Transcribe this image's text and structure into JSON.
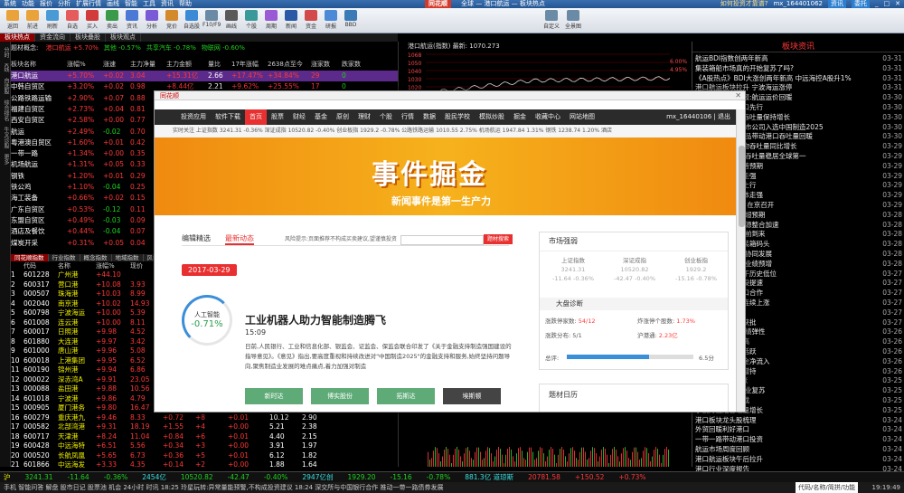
{
  "titlebar": {
    "menus": [
      "系统",
      "功能",
      "报价",
      "分析",
      "扩展行情",
      "画线",
      "智能",
      "工具",
      "资讯",
      "帮助"
    ],
    "brand": "同花顺",
    "window_title": "全球 — 港口航运 — 板块热点",
    "question": "如何投资才靠谱?",
    "user": "mx_164401062",
    "right_btns": [
      "资讯",
      "委托"
    ]
  },
  "toolbar": {
    "labels": [
      "返回",
      "前进",
      "刷新",
      "自选",
      "买入",
      "卖出",
      "资讯",
      "分析",
      "竞价",
      "自选股",
      "F10/F9",
      "画线",
      "个股",
      "周期",
      "新闻",
      "资金",
      "研报",
      "BBD"
    ],
    "right_labels": [
      "自定义",
      "全景图"
    ]
  },
  "tabs": [
    "板块热点",
    "资金流向",
    "板块叠股",
    "板块观点"
  ],
  "left_side": [
    "分时",
    "K线",
    "自选股",
    "综合排名",
    "牛叉诊股",
    "更多"
  ],
  "info_line": {
    "label": "题材概念:",
    "items": [
      {
        "t": "港口航运 +5.70%",
        "c": "up"
      },
      {
        "t": "其他 -0.57%",
        "c": "dn"
      },
      {
        "t": "共享汽车 -0.78%",
        "c": "dn"
      },
      {
        "t": "物联网 -0.60%",
        "c": "dn"
      }
    ]
  },
  "table_headers": [
    "板块名称",
    "涨幅%",
    "涨速",
    "主力净量",
    "主力金额",
    "量比",
    "17年涨幅",
    "2638点至今",
    "涨家数",
    "跌家数"
  ],
  "sectors": [
    {
      "n": "港口航运",
      "z": "+5.70%",
      "s": "+0.02",
      "a": "3.04",
      "b": "+15.31亿",
      "c": "2.66",
      "d": "+17.47%",
      "e": "+34.84%",
      "f": "29",
      "g": "0",
      "sel": true
    },
    {
      "n": "中韩自贸区",
      "z": "+3.20%",
      "s": "+0.02",
      "a": "0.98",
      "b": "+8.44亿",
      "c": "2.21",
      "d": "+9.62%",
      "e": "+25.55%",
      "f": "17",
      "g": "0"
    },
    {
      "n": "公路铁路运输",
      "z": "+2.90%",
      "s": "+0.07",
      "a": "0.88",
      "b": "+4.82亿",
      "c": "2.63",
      "d": "+12.06%",
      "e": "+35.33%",
      "f": "18",
      "g": "4"
    },
    {
      "n": "福建自贸区",
      "z": "+2.73%",
      "s": "+0.04",
      "a": "0.81",
      "b": "+3.55亿",
      "c": "2.01",
      "d": "+7.04%",
      "e": "+21.83%",
      "f": "15",
      "g": "2"
    },
    {
      "n": "西安自贸区",
      "z": "+2.58%",
      "s": "+0.00",
      "a": "0.77",
      "b": "+2.41亿",
      "c": "1.92",
      "d": "+6.33%",
      "e": "+19.70%",
      "f": "12",
      "g": "3"
    },
    {
      "n": "航运",
      "z": "+2.49%",
      "s": "-0.02",
      "a": "0.70",
      "b": "+2.20亿",
      "c": "1.88",
      "d": "+5.90%",
      "e": "+28.12%",
      "f": "11",
      "g": "1"
    },
    {
      "n": "粤港澳自贸区",
      "z": "+1.60%",
      "s": "+0.01",
      "a": "0.42",
      "b": "+1.87亿",
      "c": "1.55",
      "d": "+4.22%",
      "e": "+17.44%",
      "f": "14",
      "g": "5"
    },
    {
      "n": "一带一路",
      "z": "+1.34%",
      "s": "+0.00",
      "a": "0.35",
      "b": "+1.51亿",
      "c": "1.47",
      "d": "+3.98%",
      "e": "+22.06%",
      "f": "60",
      "g": "21"
    },
    {
      "n": "机场航运",
      "z": "+1.31%",
      "s": "+0.05",
      "a": "0.33",
      "b": "+1.12亿",
      "c": "1.40",
      "d": "+3.55%",
      "e": "+15.20%",
      "f": "9",
      "g": "2"
    },
    {
      "n": "钢铁",
      "z": "+1.20%",
      "s": "+0.01",
      "a": "0.29",
      "b": "+0.95亿",
      "c": "1.33",
      "d": "+3.10%",
      "e": "+30.51%",
      "f": "22",
      "g": "8"
    },
    {
      "n": "铁公鸡",
      "z": "+1.10%",
      "s": "-0.04",
      "a": "0.25",
      "b": "+0.80亿",
      "c": "1.28",
      "d": "+2.74%",
      "e": "+18.66%",
      "f": "30",
      "g": "10"
    },
    {
      "n": "海工装备",
      "z": "+0.66%",
      "s": "+0.02",
      "a": "0.15",
      "b": "+0.44亿",
      "c": "1.19",
      "d": "+1.90%",
      "e": "+12.38%",
      "f": "10",
      "g": "6"
    },
    {
      "n": "广东自贸区",
      "z": "+0.53%",
      "s": "-0.12",
      "a": "0.11",
      "b": "+0.31亿",
      "c": "1.14",
      "d": "+1.41%",
      "e": "+14.90%",
      "f": "13",
      "g": "8"
    },
    {
      "n": "东盟自贸区",
      "z": "+0.49%",
      "s": "-0.03",
      "a": "0.09",
      "b": "+0.22亿",
      "c": "1.10",
      "d": "+1.05%",
      "e": "+11.72%",
      "f": "8",
      "g": "5"
    },
    {
      "n": "酒店及餐饮",
      "z": "+0.44%",
      "s": "-0.04",
      "a": "0.07",
      "b": "+0.10亿",
      "c": "1.06",
      "d": "+0.98%",
      "e": "+9.85%",
      "f": "5",
      "g": "4"
    },
    {
      "n": "煤炭开采",
      "z": "+0.31%",
      "s": "+0.05",
      "a": "0.04",
      "b": "+0.06亿",
      "c": "1.02",
      "d": "+0.61%",
      "e": "+20.41%",
      "f": "16",
      "g": "12"
    }
  ],
  "low_tabs": [
    "同花顺指数",
    "行业指数",
    "概念指数",
    "地域指数",
    "风格指数"
  ],
  "stock_headers": [
    "代码",
    "名称",
    "涨幅%",
    "现价",
    "涨跌",
    "买价",
    "卖价",
    "总手",
    "现手",
    "换手%",
    "量比"
  ],
  "stocks": [
    {
      "i": "1",
      "code": "601228",
      "n": "广州港",
      "z": "+44.10",
      "p": "",
      "d": "",
      "v": "",
      "x": "",
      "t": "",
      "q": ""
    },
    {
      "i": "2",
      "code": "600317",
      "n": "营口港",
      "z": "+10.08",
      "p": "3.93",
      "d": "+0.36",
      "v": "+21",
      "x": "+0.03",
      "t": "20.51",
      "q": "4.86"
    },
    {
      "i": "3",
      "code": "000507",
      "n": "珠海港",
      "z": "+10.03",
      "p": "8.99",
      "d": "+0.82",
      "v": "+17",
      "x": "+0.01",
      "t": "18.44",
      "q": "3.91"
    },
    {
      "i": "4",
      "code": "002040",
      "n": "南京港",
      "z": "+10.02",
      "p": "14.93",
      "d": "+1.36",
      "v": "+12",
      "x": "+0.00",
      "t": "9.75",
      "q": "3.07"
    },
    {
      "i": "5",
      "code": "600798",
      "n": "宁波海运",
      "z": "+10.00",
      "p": "5.39",
      "d": "+0.49",
      "v": "+9",
      "x": "+0.00",
      "t": "7.66",
      "q": "2.95"
    },
    {
      "i": "6",
      "code": "601008",
      "n": "连云港",
      "z": "+10.00",
      "p": "8.11",
      "d": "+0.74",
      "v": "+14",
      "x": "+0.01",
      "t": "15.30",
      "q": "4.11"
    },
    {
      "i": "7",
      "code": "600017",
      "n": "日照港",
      "z": "+9.98",
      "p": "4.52",
      "d": "+0.41",
      "v": "+10",
      "x": "+0.00",
      "t": "11.92",
      "q": "3.36"
    },
    {
      "i": "8",
      "code": "601880",
      "n": "大连港",
      "z": "+9.97",
      "p": "3.42",
      "d": "+0.31",
      "v": "+8",
      "x": "+0.00",
      "t": "6.48",
      "q": "3.18"
    },
    {
      "i": "9",
      "code": "601000",
      "n": "唐山港",
      "z": "+9.96",
      "p": "5.08",
      "d": "+0.46",
      "v": "+11",
      "x": "+0.01",
      "t": "5.92",
      "q": "2.84"
    },
    {
      "i": "10",
      "code": "600018",
      "n": "上港集团",
      "z": "+9.95",
      "p": "6.52",
      "d": "+0.59",
      "v": "+13",
      "x": "+0.00",
      "t": "2.11",
      "q": "3.55"
    },
    {
      "i": "11",
      "code": "600190",
      "n": "锦州港",
      "z": "+9.94",
      "p": "6.86",
      "d": "+0.62",
      "v": "+16",
      "x": "+0.02",
      "t": "13.07",
      "q": "4.20"
    },
    {
      "i": "12",
      "code": "000022",
      "n": "深赤湾A",
      "z": "+9.91",
      "p": "23.05",
      "d": "+2.08",
      "v": "+7",
      "x": "+0.01",
      "t": "3.55",
      "q": "2.61"
    },
    {
      "i": "13",
      "code": "000088",
      "n": "盐田港",
      "z": "+9.88",
      "p": "10.56",
      "d": "+0.95",
      "v": "+9",
      "x": "+0.00",
      "t": "4.88",
      "q": "2.77"
    },
    {
      "i": "14",
      "code": "601018",
      "n": "宁波港",
      "z": "+9.86",
      "p": "4.79",
      "d": "+0.43",
      "v": "+6",
      "x": "+0.00",
      "t": "1.94",
      "q": "3.02"
    },
    {
      "i": "15",
      "code": "000905",
      "n": "厦门港务",
      "z": "+9.80",
      "p": "16.47",
      "d": "+1.47",
      "v": "+5",
      "x": "+0.00",
      "t": "8.23",
      "q": "2.49"
    },
    {
      "i": "16",
      "code": "600279",
      "n": "重庆港九",
      "z": "+9.46",
      "p": "8.33",
      "d": "+0.72",
      "v": "+8",
      "x": "+0.01",
      "t": "10.12",
      "q": "2.90"
    },
    {
      "i": "17",
      "code": "000582",
      "n": "北部湾港",
      "z": "+9.31",
      "p": "18.19",
      "d": "+1.55",
      "v": "+4",
      "x": "+0.00",
      "t": "5.21",
      "q": "2.38"
    },
    {
      "i": "18",
      "code": "600717",
      "n": "天津港",
      "z": "+8.24",
      "p": "11.04",
      "d": "+0.84",
      "v": "+6",
      "x": "+0.01",
      "t": "4.40",
      "q": "2.15"
    },
    {
      "i": "19",
      "code": "600428",
      "n": "中远海特",
      "z": "+6.51",
      "p": "5.56",
      "d": "+0.34",
      "v": "+3",
      "x": "+0.00",
      "t": "3.91",
      "q": "1.97"
    },
    {
      "i": "20",
      "code": "000520",
      "n": "长航凤凰",
      "z": "+5.65",
      "p": "6.73",
      "d": "+0.36",
      "v": "+5",
      "x": "+0.01",
      "t": "6.12",
      "q": "1.82"
    },
    {
      "i": "21",
      "code": "601866",
      "n": "中远海发",
      "z": "+3.33",
      "p": "4.35",
      "d": "+0.14",
      "v": "+2",
      "x": "+0.00",
      "t": "1.88",
      "q": "1.64"
    }
  ],
  "chart": {
    "title": "港口航运(指数) 最新: 1070.273",
    "y_labels": [
      "1068",
      "1050",
      "1040",
      "1030",
      "1020",
      "1010",
      "1000"
    ],
    "right_pct": [
      "6.00%",
      "4.95%"
    ]
  },
  "news": {
    "title": "板块资讯",
    "items": [
      {
        "t": "航运BDI指数创两年新高",
        "d": "03-31"
      },
      {
        "t": "集装箱船市场真的开始复苏了吗?",
        "d": "03-31"
      },
      {
        "t": "《A股热点》BDI大涨创两年新高 中远海控A股升1%",
        "d": "03-31"
      },
      {
        "t": "港口航运板块拉升 宁波海运涨停",
        "d": "03-31"
      },
      {
        "t": "交通运输行业周报:航运运价回暖",
        "d": "03-30"
      },
      {
        "t": "一带一路建设港口先行",
        "d": "03-30"
      },
      {
        "t": "中国港口集装箱吞吐量保持增长",
        "d": "03-30"
      },
      {
        "t": "公告解读:两家上市公司入选中国制造2025",
        "d": "03-30"
      },
      {
        "t": "港口板块:大宗商品带动港口吞吐量回暖",
        "d": "03-30"
      },
      {
        "t": "日照港一季度货物吞吐量同比增长",
        "d": "03-29"
      },
      {
        "t": "上港集团:集装箱吞吐量稳居全球第一",
        "d": "03-29"
      },
      {
        "t": "外贸港口业绩改善预期",
        "d": "03-29"
      },
      {
        "t": "自贸区扩容概念走强",
        "d": "03-29"
      },
      {
        "t": "干散货运价持续上行",
        "d": "03-29"
      },
      {
        "t": "港口航运板块集体走强",
        "d": "03-29"
      },
      {
        "t": "一带一路峰会5月在京召开",
        "d": "03-29"
      },
      {
        "t": "港口:吞吐量数据超预期",
        "d": "03-28"
      },
      {
        "t": "国企改革:港口资源整合加速",
        "d": "03-28"
      },
      {
        "t": "航运:集运旺季提前到来",
        "d": "03-28"
      },
      {
        "t": "盐田港拟投建集装箱码头",
        "d": "03-28"
      },
      {
        "t": "交通部:推进港口协同发展",
        "d": "03-28"
      },
      {
        "t": "中远海控:一季度业绩预增",
        "d": "03-28"
      },
      {
        "t": "港口板块估值处于历史低位",
        "d": "03-27"
      },
      {
        "t": "国际航运中心建设提速",
        "d": "03-27"
      },
      {
        "t": "海上丝绸之路港口合作",
        "d": "03-27"
      },
      {
        "t": "集装箱运价指数连续上涨",
        "d": "03-27"
      },
      {
        "t": "航运景气度回升",
        "d": "03-27"
      },
      {
        "t": "天津港整合方案获批",
        "d": "03-27"
      },
      {
        "t": "港口行业:关注业绩弹性",
        "d": "03-26"
      },
      {
        "t": "散货船运价创新高",
        "d": "03-26"
      },
      {
        "t": "中韩自贸区概念活跃",
        "d": "03-26"
      },
      {
        "t": "港口航运板块资金净流入",
        "d": "03-26"
      },
      {
        "t": "航运龙头获机构增持",
        "d": "03-26"
      },
      {
        "t": "BDI指数连续上涨",
        "d": "03-25"
      },
      {
        "t": "港口航运:看好行业复苏",
        "d": "03-25"
      },
      {
        "t": "集运联盟重组完成",
        "d": "03-25"
      },
      {
        "t": "宁波舟山港吞吐量增长",
        "d": "03-25"
      },
      {
        "t": "港口板块龙头股梳理",
        "d": "03-24"
      },
      {
        "t": "外贸回暖利好港口",
        "d": "03-24"
      },
      {
        "t": "一带一路带动港口投资",
        "d": "03-24"
      },
      {
        "t": "航运市场周度回顾",
        "d": "03-24"
      },
      {
        "t": "港口航运板块午后拉升",
        "d": "03-24"
      },
      {
        "t": "港口行业深度报告",
        "d": "03-24"
      }
    ]
  },
  "bottom": {
    "items": [
      {
        "t": "沪",
        "c": "yl"
      },
      {
        "t": "3241.31",
        "c": "dn"
      },
      {
        "t": "-11.64",
        "c": "dn"
      },
      {
        "t": "-0.36%",
        "c": "dn"
      },
      {
        "t": "2454亿",
        "c": "cy"
      },
      {
        "t": "10520.82",
        "c": "dn"
      },
      {
        "t": "-42.47",
        "c": "dn"
      },
      {
        "t": "-0.40%",
        "c": "dn"
      },
      {
        "t": "2947亿创",
        "c": "cy"
      },
      {
        "t": "1929.20",
        "c": "dn"
      },
      {
        "t": "-15.16",
        "c": "dn"
      },
      {
        "t": "-0.78%",
        "c": "dn"
      },
      {
        "t": "881.3亿 道琼斯",
        "c": "cy"
      },
      {
        "t": "20781.58",
        "c": "up"
      },
      {
        "t": "+150.52",
        "c": "up"
      },
      {
        "t": "+0.73%",
        "c": "up"
      }
    ],
    "status": "手机 智能问答 解盘 股市日记 股票池 机会 24小时 时讯 18:25 玲星玩转:异常量能预警,不构成投资建议 18:24 深交所与中国银行合作 推动一带一路债券发展",
    "status_right": "代码/名称/简拼/功能",
    "time": "19:19:49"
  },
  "popup": {
    "title": "同花顺",
    "close": "✕",
    "nav": [
      "投资应用",
      "软件下载",
      "首页",
      "股票",
      "财经",
      "基金",
      "原创",
      "理财",
      "个股",
      "行情",
      "数据",
      "股民学校",
      "模拟炒股",
      "掘金",
      "收藏中心",
      "网站地图"
    ],
    "user": "mx_16440106 | 退出",
    "market": "实时关注  上证指数 3241.31 -0.36%  深证成指 10520.82 -0.40%  创业板指 1929.2 -0.78%  公路铁路运输 1010.55 2.75%  机场航运 1947.84 1.31%  钢铁 1238.74 1.20%  酒店",
    "banner_big": "事件掘金",
    "banner_sub": "新闻事件是第一生产力",
    "tabs": [
      "编辑精选",
      "最新动态"
    ],
    "risk": "风险提示:页面推荐不构成买卖建议,望谨慎投资",
    "search_btn": "题材搜索",
    "date": "2017-03-29",
    "topic": "人工智能",
    "topic_pct": "-0.71%",
    "news_title": "工业机器人助力智能制造腾飞",
    "news_time": "15:09",
    "news_body": "日前,人民银行、工业和信息化部、银监会、证监会、保监会联合印发了《关于金融支持制造强国建设的指导意见》。《意见》指出,要高度重视和持续改进对\"中国制造2025\"的金融支持和服务,始终坚持问题导向,聚焦制造业发展的难点痛点,着力加强对制造",
    "stocks": [
      "新时达",
      "博实股份",
      "拓斯达",
      "埃斯顿"
    ],
    "market_panel": {
      "title": "市场强弱",
      "cols": [
        {
          "n": "上证指数",
          "v": "3241.31",
          "c": "-11.64 -0.36%"
        },
        {
          "n": "深证成指",
          "v": "10520.82",
          "c": "-42.47 -0.40%"
        },
        {
          "n": "创业板指",
          "v": "1929.2",
          "c": "-15.16 -0.78%"
        }
      ],
      "diag_title": "大盘诊断",
      "l1": "涨跌停家数:",
      "v1": "54/12",
      "l2": "炸涨停个股数:",
      "v2": "1.73%",
      "l3": "涨跌分布:",
      "v3": "5/1",
      "l4": "沪港通:",
      "v4": "2.23亿",
      "score_label": "总评:",
      "score": "6.5分",
      "score_frac": 0.65
    },
    "calendar_title": "题材日历"
  }
}
